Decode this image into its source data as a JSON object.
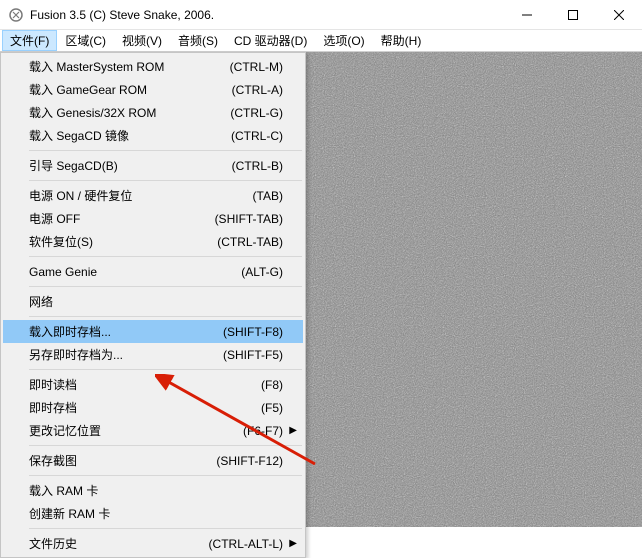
{
  "window": {
    "title": "Fusion 3.5 (C) Steve Snake, 2006."
  },
  "menubar": {
    "items": [
      {
        "label": "文件(F)",
        "open": true
      },
      {
        "label": "区域(C)"
      },
      {
        "label": "视频(V)"
      },
      {
        "label": "音频(S)"
      },
      {
        "label": "CD 驱动器(D)"
      },
      {
        "label": "选项(O)"
      },
      {
        "label": "帮助(H)"
      }
    ]
  },
  "file_menu": [
    {
      "type": "item",
      "label": "载入 MasterSystem ROM",
      "shortcut": "(CTRL-M)"
    },
    {
      "type": "item",
      "label": "载入 GameGear ROM",
      "shortcut": "(CTRL-A)"
    },
    {
      "type": "item",
      "label": "载入 Genesis/32X ROM",
      "shortcut": "(CTRL-G)"
    },
    {
      "type": "item",
      "label": "载入 SegaCD 镜像",
      "shortcut": "(CTRL-C)"
    },
    {
      "type": "sep"
    },
    {
      "type": "item",
      "label": "引导 SegaCD(B)",
      "shortcut": "(CTRL-B)"
    },
    {
      "type": "sep"
    },
    {
      "type": "item",
      "label": "电源 ON / 硬件复位",
      "shortcut": "(TAB)"
    },
    {
      "type": "item",
      "label": "电源 OFF",
      "shortcut": "(SHIFT-TAB)"
    },
    {
      "type": "item",
      "label": "软件复位(S)",
      "shortcut": "(CTRL-TAB)"
    },
    {
      "type": "sep"
    },
    {
      "type": "item",
      "label": "Game Genie",
      "shortcut": "(ALT-G)"
    },
    {
      "type": "sep"
    },
    {
      "type": "item",
      "label": "网络",
      "shortcut": ""
    },
    {
      "type": "sep"
    },
    {
      "type": "item",
      "label": "载入即时存档...",
      "shortcut": "(SHIFT-F8)",
      "highlight": true
    },
    {
      "type": "item",
      "label": "另存即时存档为...",
      "shortcut": "(SHIFT-F5)"
    },
    {
      "type": "sep"
    },
    {
      "type": "item",
      "label": "即时读档",
      "shortcut": "(F8)"
    },
    {
      "type": "item",
      "label": "即时存档",
      "shortcut": "(F5)"
    },
    {
      "type": "item",
      "label": "更改记忆位置",
      "shortcut": "(F6-F7)",
      "submenu": true
    },
    {
      "type": "sep"
    },
    {
      "type": "item",
      "label": "保存截图",
      "shortcut": "(SHIFT-F12)"
    },
    {
      "type": "sep"
    },
    {
      "type": "item",
      "label": "载入 RAM 卡",
      "shortcut": ""
    },
    {
      "type": "item",
      "label": "创建新 RAM 卡",
      "shortcut": ""
    },
    {
      "type": "sep"
    },
    {
      "type": "item",
      "label": "文件历史",
      "shortcut": "(CTRL-ALT-L)",
      "submenu": true
    }
  ]
}
